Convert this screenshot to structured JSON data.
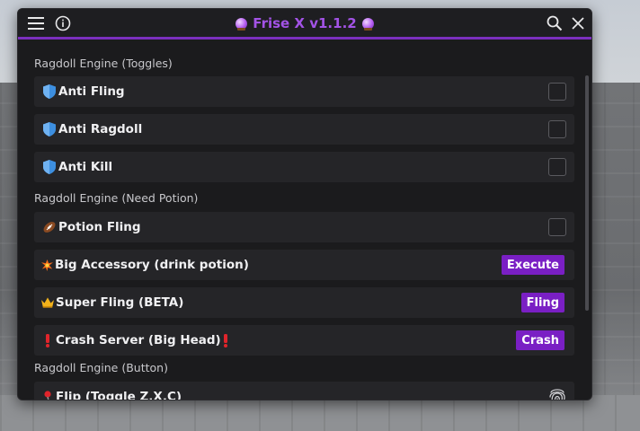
{
  "window": {
    "title": "Frise X v1.1.2",
    "accent_color": "#7b2fbe",
    "title_color": "#a353e6"
  },
  "titlebar": {
    "menu_icon": "hamburger-menu-icon",
    "info_icon": "info-icon",
    "search_icon": "search-icon",
    "close_icon": "close-icon"
  },
  "sections": [
    {
      "label": "Ragdoll Engine (Toggles)",
      "rows": [
        {
          "icon": "shield-icon",
          "label": "Anti Fling",
          "control": "checkbox",
          "checked": false
        },
        {
          "icon": "shield-icon",
          "label": "Anti Ragdoll",
          "control": "checkbox",
          "checked": false
        },
        {
          "icon": "shield-icon",
          "label": "Anti Kill",
          "control": "checkbox",
          "checked": false
        }
      ]
    },
    {
      "label": "Ragdoll Engine (Need Potion)",
      "rows": [
        {
          "icon": "football-icon",
          "label": "Potion Fling",
          "control": "checkbox",
          "checked": false
        },
        {
          "icon": "explosion-icon",
          "label": "Big Accessory (drink potion)",
          "control": "button",
          "button_label": "Execute"
        },
        {
          "icon": "crown-icon",
          "label": "Super Fling (BETA)",
          "control": "button",
          "button_label": "Fling"
        },
        {
          "icon": "exclamation-icon",
          "label": "Crash Server (Big Head)",
          "control": "button",
          "button_label": "Crash",
          "trailing_icon": "exclamation-icon"
        }
      ]
    },
    {
      "label": "Ragdoll Engine (Button)",
      "rows": [
        {
          "icon": "pin-icon",
          "label": "Flip (Toggle Z,X,C)",
          "control": "fingerprint",
          "control_icon": "fingerprint-icon"
        }
      ]
    }
  ],
  "colors": {
    "button_bg": "#7a1fc4",
    "row_bg": "#252528",
    "window_bg": "#1b1b1d"
  }
}
